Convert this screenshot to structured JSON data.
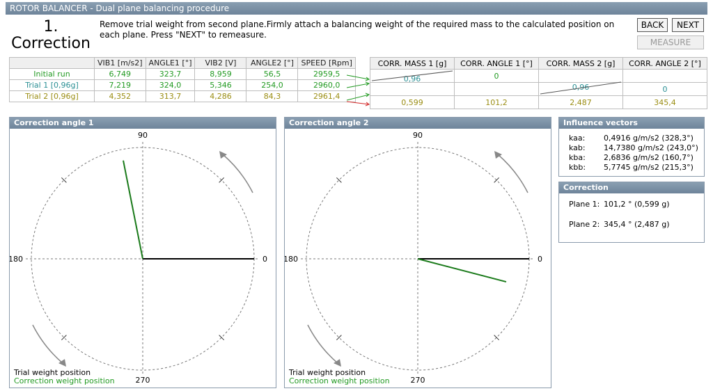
{
  "window": {
    "title": "ROTOR BALANCER - Dual plane balancing procedure"
  },
  "step": {
    "number": "1.",
    "title": "Correction"
  },
  "instructions": "Remove trial weight from second plane.Firmly attach a balancing weight of the required mass to the calculated position on each plane. Press \"NEXT\" to remeasure.",
  "buttons": {
    "back": "BACK",
    "next": "NEXT",
    "measure": "MEASURE"
  },
  "table": {
    "headers": [
      "",
      "VIB1 [m/s2]",
      "ANGLE1 [°]",
      "VIB2 [V]",
      "ANGLE2 [°]",
      "SPEED [Rpm]"
    ],
    "rows": [
      {
        "label": "Initial run",
        "vib1": "6,749",
        "angle1": "323,7",
        "vib2": "8,959",
        "angle2": "56,5",
        "speed": "2959,5"
      },
      {
        "label": "Trial 1 [0,96g]",
        "vib1": "7,219",
        "angle1": "324,0",
        "vib2": "5,346",
        "angle2": "254,0",
        "speed": "2960,0"
      },
      {
        "label": "Trial 2 [0,96g]",
        "vib1": "4,352",
        "angle1": "313,7",
        "vib2": "4,286",
        "angle2": "84,3",
        "speed": "2961,4"
      }
    ]
  },
  "correction_table": {
    "headers": [
      "CORR. MASS 1 [g]",
      "CORR. ANGLE 1 [°]",
      "CORR. MASS 2 [g]",
      "CORR. ANGLE 2 [°]"
    ],
    "trial1_mass": "0,96",
    "trial1_angle": "0",
    "trial2_mass": "0,96",
    "trial2_angle": "0",
    "result": {
      "mass1": "0,599",
      "angle1": "101,2",
      "mass2": "2,487",
      "angle2": "345,4"
    }
  },
  "plots": [
    {
      "title": "Correction angle 1",
      "label_90": "90",
      "label_180": "180",
      "label_0": "0",
      "label_270": "270",
      "trial_angle_deg": 0,
      "correction_angle_deg": 101.2,
      "correction_magnitude": 0.9
    },
    {
      "title": "Correction angle 2",
      "label_90": "90",
      "label_180": "180",
      "label_0": "0",
      "label_270": "270",
      "trial_angle_deg": 0,
      "correction_angle_deg": 345.4,
      "correction_magnitude": 0.82
    }
  ],
  "legend": {
    "trial": "Trial weight position",
    "correction": "Correction weight position"
  },
  "influence": {
    "title": "Influence vectors",
    "rows": [
      {
        "key": "kaa:",
        "value": "0,4916 g/m/s2  (328,3°)"
      },
      {
        "key": "kab:",
        "value": "14,7380 g/m/s2  (243,0°)"
      },
      {
        "key": "kba:",
        "value": "2,6836 g/m/s2  (160,7°)"
      },
      {
        "key": "kbb:",
        "value": "5,7745 g/m/s2  (215,3°)"
      }
    ]
  },
  "correction": {
    "title": "Correction",
    "plane1_label": "Plane 1:",
    "plane1_value": "101,2 ° (0,599 g)",
    "plane2_label": "Plane 2:",
    "plane2_value": "345,4 ° (2,487 g)"
  },
  "colors": {
    "header": "#7a8fa4",
    "green": "#229a22",
    "teal": "#2a8f94",
    "olive": "#9a8d12",
    "red": "#d22222"
  }
}
